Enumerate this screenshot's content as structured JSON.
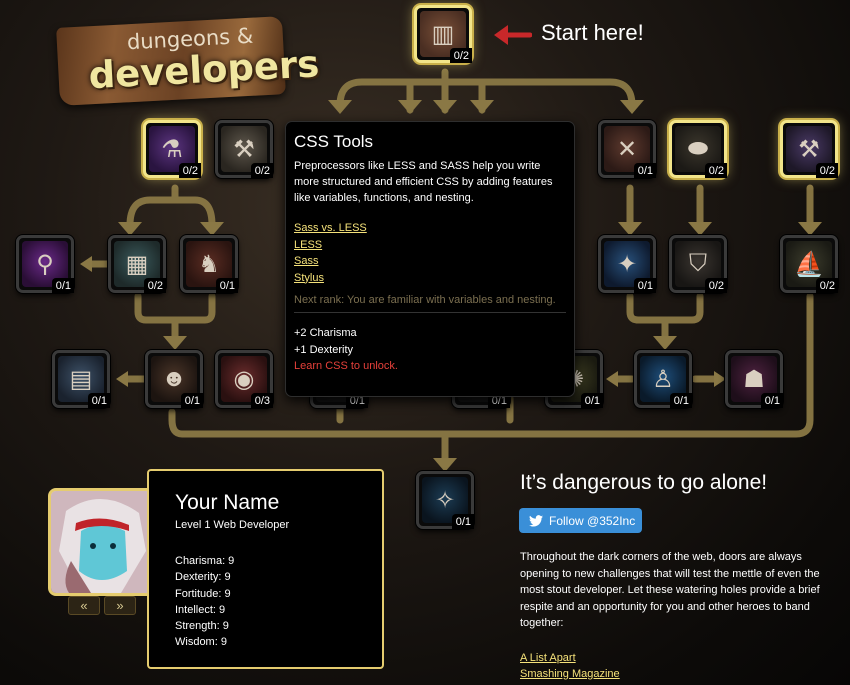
{
  "logo": {
    "line1": "dungeons &",
    "line2": "developers"
  },
  "start": {
    "text": "Start here!"
  },
  "nodes": [
    {
      "id": "root",
      "rank": "0/2",
      "icon": "book-icon",
      "highlight": true
    },
    {
      "id": "l1-a",
      "rank": "0/2",
      "icon": "potion-icon",
      "highlight": true
    },
    {
      "id": "l1-b",
      "rank": "0/2",
      "icon": "hammer-icon",
      "highlight": false
    },
    {
      "id": "l1-c",
      "rank": "0/1",
      "icon": "crossbow-icon",
      "highlight": false
    },
    {
      "id": "l1-d",
      "rank": "0/2",
      "icon": "barrel-icon",
      "highlight": true
    },
    {
      "id": "l1-e",
      "rank": "0/2",
      "icon": "warhammer-icon",
      "highlight": true
    },
    {
      "id": "l2-a",
      "rank": "0/1",
      "icon": "vial-icon",
      "highlight": false
    },
    {
      "id": "l2-b",
      "rank": "0/2",
      "icon": "map-table-icon",
      "highlight": false
    },
    {
      "id": "l2-c",
      "rank": "0/1",
      "icon": "warrior-icon",
      "highlight": false
    },
    {
      "id": "l2-d",
      "rank": "0/1",
      "icon": "wand-icon",
      "highlight": false
    },
    {
      "id": "l2-e",
      "rank": "0/2",
      "icon": "shield-icon",
      "highlight": false
    },
    {
      "id": "l2-f",
      "rank": "0/2",
      "icon": "ship-icon",
      "highlight": false
    },
    {
      "id": "l3-a",
      "rank": "0/1",
      "icon": "scroll-icon",
      "highlight": false
    },
    {
      "id": "l3-b",
      "rank": "0/1",
      "icon": "silhouette-icon",
      "highlight": false
    },
    {
      "id": "l3-c",
      "rank": "0/3",
      "icon": "orb-icon",
      "highlight": false
    },
    {
      "id": "l3-d",
      "rank": "0/1",
      "icon": "hidden-node-icon",
      "highlight": false
    },
    {
      "id": "l3-e",
      "rank": "0/1",
      "icon": "hidden-node-icon",
      "highlight": false
    },
    {
      "id": "l3-f",
      "rank": "0/1",
      "icon": "rune-disc-icon",
      "highlight": false
    },
    {
      "id": "l3-g",
      "rank": "0/1",
      "icon": "blue-figure-icon",
      "highlight": false
    },
    {
      "id": "l3-h",
      "rank": "0/1",
      "icon": "mask-icon",
      "highlight": false
    },
    {
      "id": "final",
      "rank": "0/1",
      "icon": "glowing-figure-icon",
      "highlight": false
    }
  ],
  "tooltip": {
    "title": "CSS Tools",
    "desc": "Preprocessors like LESS and SASS help you write more structured and efficient CSS by adding features like variables, functions, and nesting.",
    "links": [
      "Sass vs. LESS",
      "LESS",
      "Sass",
      "Stylus"
    ],
    "next_rank": "Next rank: You are familiar with variables and nesting.",
    "bonus1": "+2 Charisma",
    "bonus2": "+1 Dexterity",
    "unlock": "Learn CSS to unlock.",
    "unlock_color": "#e5403a"
  },
  "character": {
    "name": "Your Name",
    "level": "Level 1 Web Developer",
    "stats": [
      "Charisma: 9",
      "Dexterity: 9",
      "Fortitude: 9",
      "Intellect: 9",
      "Strength: 9",
      "Wisdom: 9"
    ],
    "prev_label": "«",
    "next_label": "»"
  },
  "right": {
    "title": "It’s dangerous to go alone!",
    "follow_label": "Follow @352Inc",
    "body": "Throughout the dark corners of the web, doors are always opening to new challenges that will test the mettle of even the most stout developer. Let these watering holes provide a brief respite and an opportunity for you and other heroes to band together:",
    "links": [
      "A List Apart",
      "Smashing Magazine"
    ]
  },
  "colors": {
    "accent": "#f2e58a",
    "connector": "#8c7a48",
    "follow_blue": "#3a8fd8",
    "link": "#f5e27a"
  }
}
